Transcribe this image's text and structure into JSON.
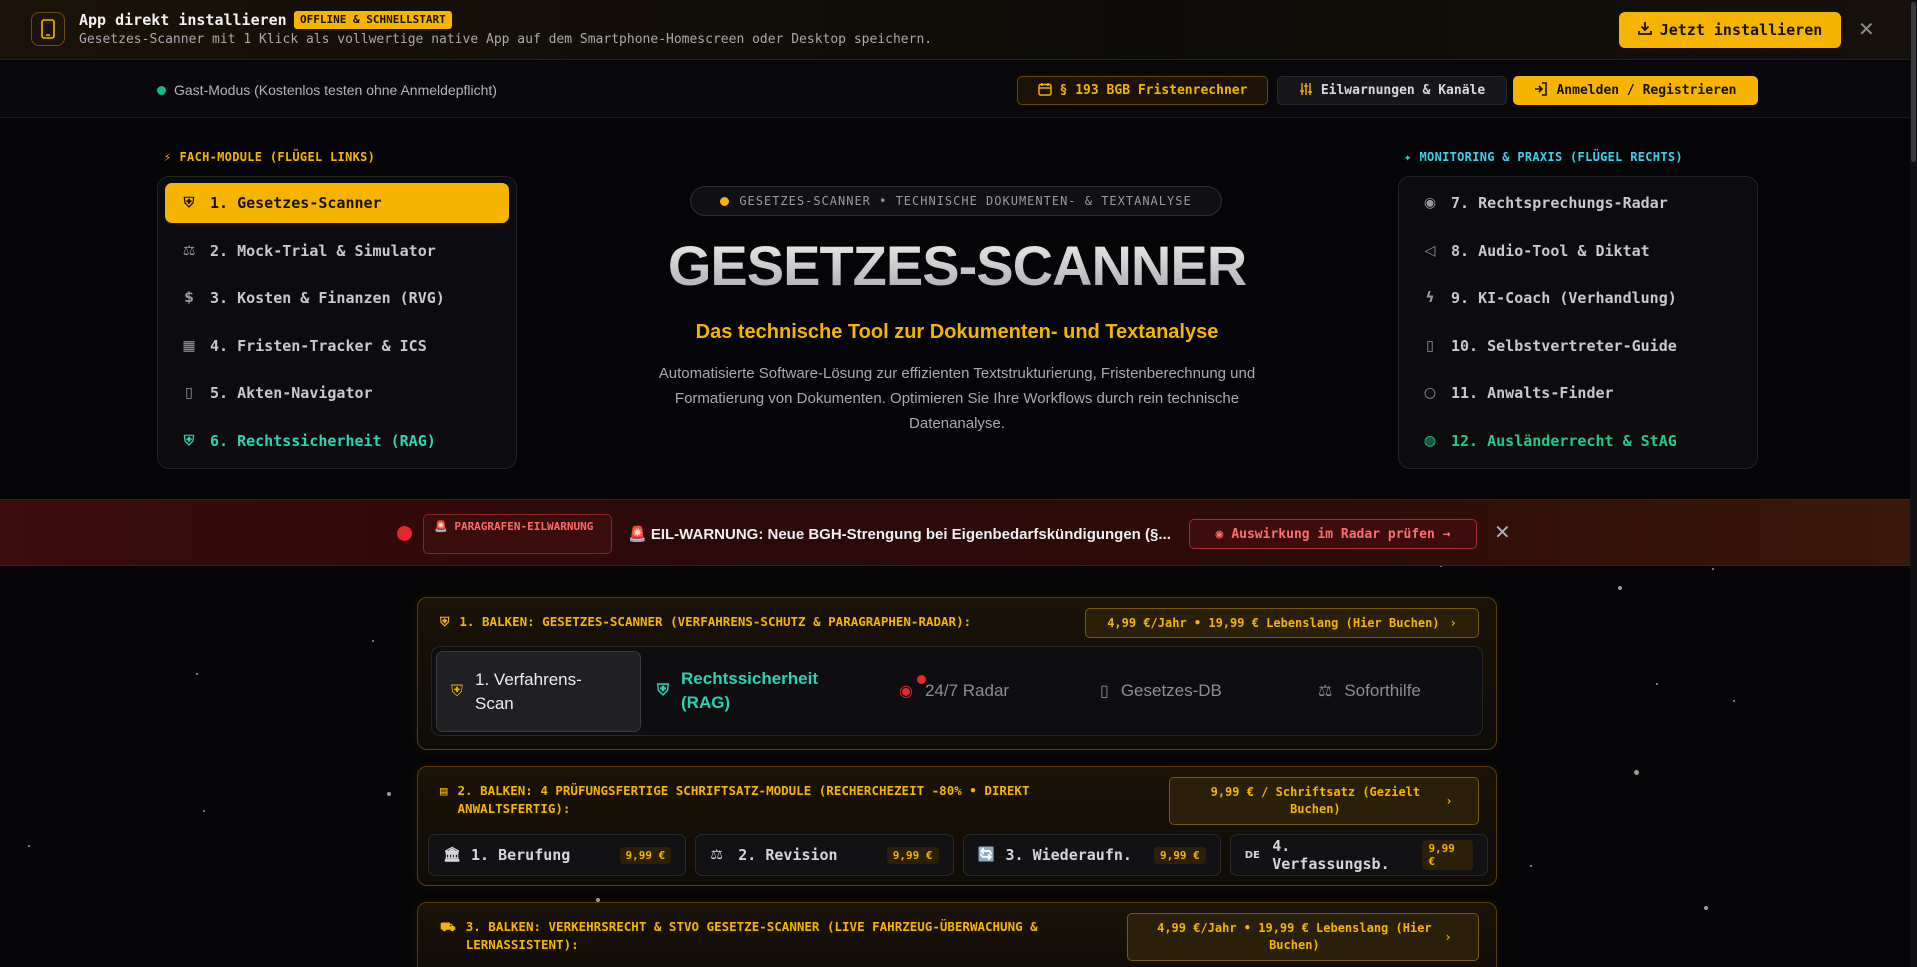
{
  "install": {
    "title": "App direkt installieren",
    "badge": "OFFLINE & SCHNELLSTART",
    "subtitle": "Gesetzes-Scanner mit 1 Klick als vollwertige native App auf dem Smartphone-Homescreen oder Desktop speichern.",
    "button": "Jetzt installieren",
    "close": "✕"
  },
  "nav": {
    "guest": "Gast-Modus (Kostenlos testen ohne Anmeldepflicht)",
    "fristen": "§ 193 BGB Fristenrechner",
    "eil": "Eilwarnungen & Kanäle",
    "login": "Anmelden / Registrieren"
  },
  "left_panel": {
    "heading": "FACH-MODULE (FLÜGEL LINKS)",
    "items": [
      {
        "label": "1. Gesetzes-Scanner",
        "icon": "shield-icon"
      },
      {
        "label": "2. Mock-Trial & Simulator",
        "icon": "scale-icon"
      },
      {
        "label": "3. Kosten & Finanzen (RVG)",
        "icon": "dollar-icon"
      },
      {
        "label": "4. Fristen-Tracker & ICS",
        "icon": "calendar-icon"
      },
      {
        "label": "5. Akten-Navigator",
        "icon": "book-icon"
      },
      {
        "label": "6. Rechtssicherheit (RAG)",
        "icon": "shield-check-icon"
      }
    ]
  },
  "right_panel": {
    "heading": "MONITORING & PRAXIS (FLÜGEL RECHTS)",
    "items": [
      {
        "label": "7. Rechtsprechungs-Radar",
        "icon": "radio-icon"
      },
      {
        "label": "8. Audio-Tool & Diktat",
        "icon": "speaker-icon"
      },
      {
        "label": "9. KI-Coach (Verhandlung)",
        "icon": "bolt-icon"
      },
      {
        "label": "10. Selbstvertreter-Guide",
        "icon": "book-icon"
      },
      {
        "label": "11. Anwalts-Finder",
        "icon": "search-icon"
      },
      {
        "label": "12. Ausländerrecht & StAG",
        "icon": "globe-icon"
      }
    ]
  },
  "hero": {
    "pill": "GESETZES-SCANNER • TECHNISCHE DOKUMENTEN- & TEXTANALYSE",
    "title": "GESETZES-SCANNER",
    "subtitle": "Das technische Tool zur Dokumenten- und Textanalyse",
    "description": "Automatisierte Software-Lösung zur effizienten Textstrukturierung, Fristenberechnung und Formatierung von Dokumenten. Optimieren Sie Ihre Workflows durch rein technische Datenanalyse."
  },
  "warning": {
    "tag": "🚨 PARAGRAFEN-EILWARNUNG",
    "text": "🚨 EIL-WARNUNG: Neue BGH-Strengung bei Eigenbedarfskündigungen (§...",
    "button": "Auswirkung im Radar prüfen →",
    "close": "✕"
  },
  "bar1": {
    "title": "1. BALKEN: GESETZES-SCANNER (VERFAHRENS-SCHUTZ & PARAGRAPHEN-RADAR):",
    "price": "4,99 €/Jahr • 19,99 € Lebenslang (Hier Buchen)",
    "tabs": [
      "1. Verfahrens-Scan",
      "Rechtssicherheit (RAG)",
      "24/7 Radar",
      "Gesetzes-DB",
      "Soforthilfe"
    ]
  },
  "bar2": {
    "title": "2. BALKEN: 4 PRÜFUNGSFERTIGE SCHRIFTSATZ-MODULE (RECHERCHEZEIT -80% • DIREKT ANWALTSFERTIG):",
    "price": "9,99 € / Schriftsatz (Gezielt Buchen)",
    "modules": [
      {
        "icon": "🏛",
        "label": "1. Berufung",
        "price": "9,99 €"
      },
      {
        "icon": "⚖",
        "label": "2. Revision",
        "price": "9,99 €"
      },
      {
        "icon": "🔄",
        "label": "3. Wiederaufn.",
        "price": "9,99 €"
      },
      {
        "icon": "DE",
        "label": "4. Verfassungsb.",
        "price": "9,99 €"
      }
    ]
  },
  "bar3": {
    "title": "3. BALKEN: VERKEHRSRECHT & STVO GESETZE-SCANNER (LIVE FAHRZEUG-ÜBERWACHUNG & LERNASSISTENT):",
    "price": "4,99 €/Jahr • 19,99 € Lebenslang (Hier Buchen)"
  },
  "colors": {
    "accent": "#f5b400",
    "teal": "#2ad6b0",
    "danger": "#e3262f",
    "cyan": "#3fd0e8"
  }
}
